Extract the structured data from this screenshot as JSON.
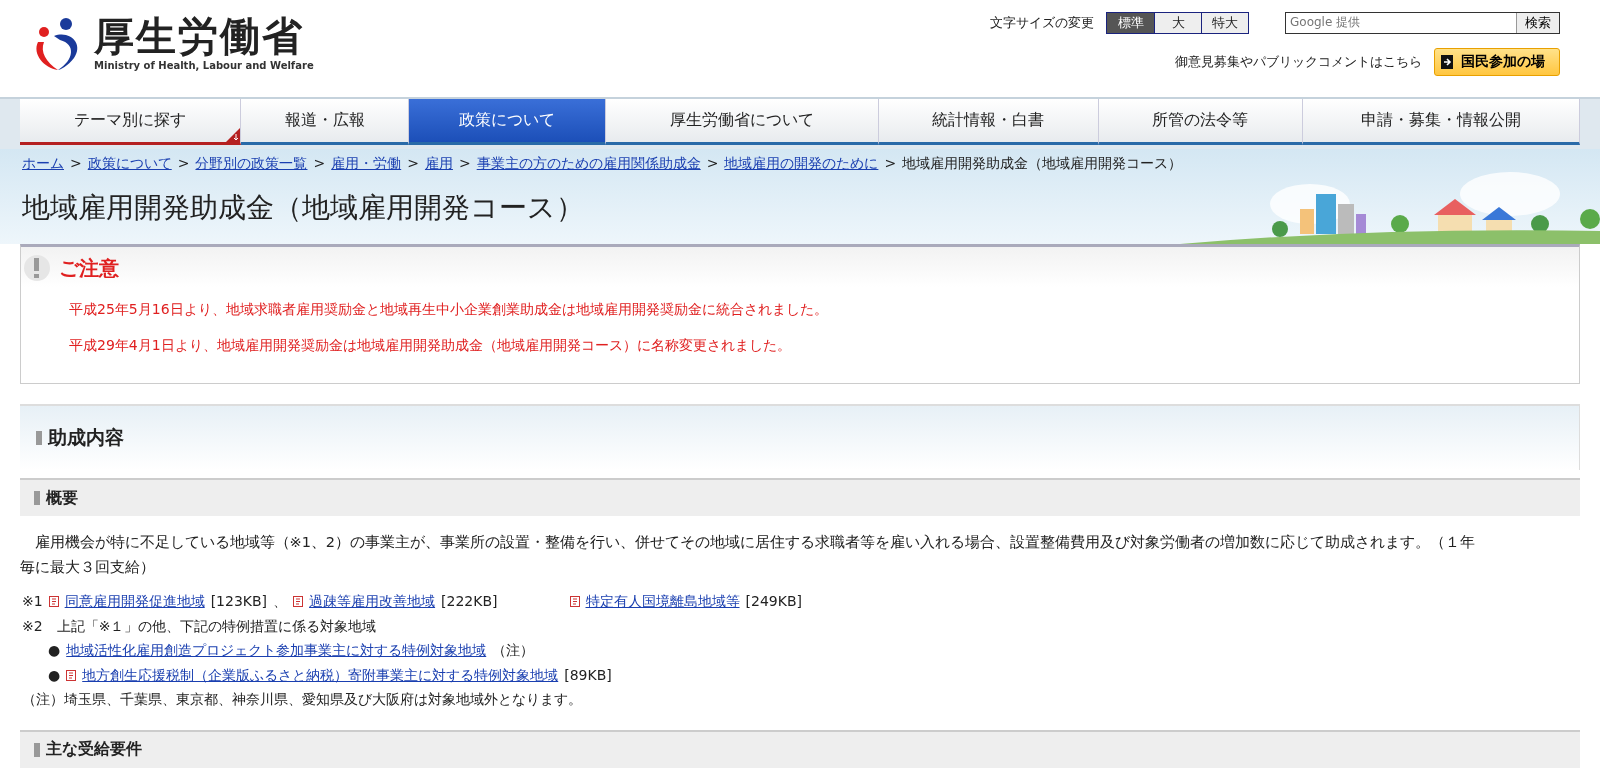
{
  "header": {
    "logo_name": "厚生労働省",
    "logo_english": "Ministry of Health, Labour and Welfare",
    "font_size_label": "文字サイズの変更",
    "font_sizes": [
      {
        "label": "標準",
        "selected": true
      },
      {
        "label": "大",
        "selected": false
      },
      {
        "label": "特大",
        "selected": false
      }
    ],
    "search": {
      "placeholder": "Google 提供",
      "button": "検索"
    },
    "comment_text": "御意見募集やパブリックコメントはこちら",
    "participation_button": "国民参加の場"
  },
  "nav": [
    {
      "label": "テーマ別に探す",
      "selected": false,
      "kind": "menu"
    },
    {
      "label": "報道・広報",
      "selected": false,
      "kind": "plain"
    },
    {
      "label": "政策について",
      "selected": true,
      "kind": "plain"
    },
    {
      "label": "厚生労働省について",
      "selected": false,
      "kind": "plain"
    },
    {
      "label": "統計情報・白書",
      "selected": false,
      "kind": "plain"
    },
    {
      "label": "所管の法令等",
      "selected": false,
      "kind": "plain"
    },
    {
      "label": "申請・募集・情報公開",
      "selected": false,
      "kind": "plain"
    }
  ],
  "breadcrumb": [
    {
      "label": "ホーム",
      "link": true
    },
    {
      "label": "政策について",
      "link": true
    },
    {
      "label": "分野別の政策一覧",
      "link": true
    },
    {
      "label": "雇用・労働",
      "link": true
    },
    {
      "label": "雇用",
      "link": true
    },
    {
      "label": "事業主の方のための雇用関係助成金",
      "link": true
    },
    {
      "label": "地域雇用の開発のために",
      "link": true
    },
    {
      "label": "地域雇用開発助成金（地域雇用開発コース）",
      "link": false
    }
  ],
  "breadcrumb_separator": ">",
  "page_title": "地域雇用開発助成金（地域雇用開発コース）",
  "notice": {
    "heading": "ご注意",
    "lines": [
      "平成25年5月16日より、地域求職者雇用奨励金と地域再生中小企業創業助成金は地域雇用開発奨励金に統合されました。",
      "平成29年4月1日より、地域雇用開発奨励金は地域雇用開発助成金（地域雇用開発コース）に名称変更されました。"
    ]
  },
  "section": {
    "heading": "助成内容",
    "subsections": [
      {
        "heading": "概要",
        "paragraph": "雇用機会が特に不足している地域等（※1、2）の事業主が、事業所の設置・整備を行い、併せてその地域に居住する求職者等を雇い入れる場合、設置整備費用及び対象労働者の増加数に応じて助成されます。（１年毎に最大３回支給）",
        "notes": [
          [
            {
              "kind": "text",
              "text": "※1"
            },
            {
              "kind": "pdf",
              "text": "同意雇用開発促進地域"
            },
            {
              "kind": "text",
              "text": "[123KB]"
            },
            {
              "kind": "text",
              "text": "、"
            },
            {
              "kind": "pdf",
              "text": "過疎等雇用改善地域"
            },
            {
              "kind": "text",
              "text": "[222KB]"
            },
            {
              "kind": "gap"
            },
            {
              "kind": "pdf",
              "text": "特定有人国境離島地域等"
            },
            {
              "kind": "text",
              "text": "[249KB]"
            }
          ],
          [
            {
              "kind": "text",
              "text": "※2　上記「※１」の他、下記の特例措置に係る対象地域"
            }
          ],
          [
            {
              "kind": "indent"
            },
            {
              "kind": "text",
              "text": "●"
            },
            {
              "kind": "link",
              "text": "地域活性化雇用創造プロジェクト参加事業主に対する特例対象地域"
            },
            {
              "kind": "text",
              "text": "（注）"
            }
          ],
          [
            {
              "kind": "indent"
            },
            {
              "kind": "text",
              "text": "●"
            },
            {
              "kind": "pdf",
              "text": "地方創生応援税制（企業版ふるさと納税）寄附事業主に対する特例対象地域"
            },
            {
              "kind": "text",
              "text": "[89KB]"
            }
          ],
          [
            {
              "kind": "text",
              "text": "（注）埼玉県、千葉県、東京都、神奈川県、愛知県及び大阪府は対象地域外となります。"
            }
          ]
        ]
      },
      {
        "heading": "主な受給要件"
      }
    ]
  }
}
